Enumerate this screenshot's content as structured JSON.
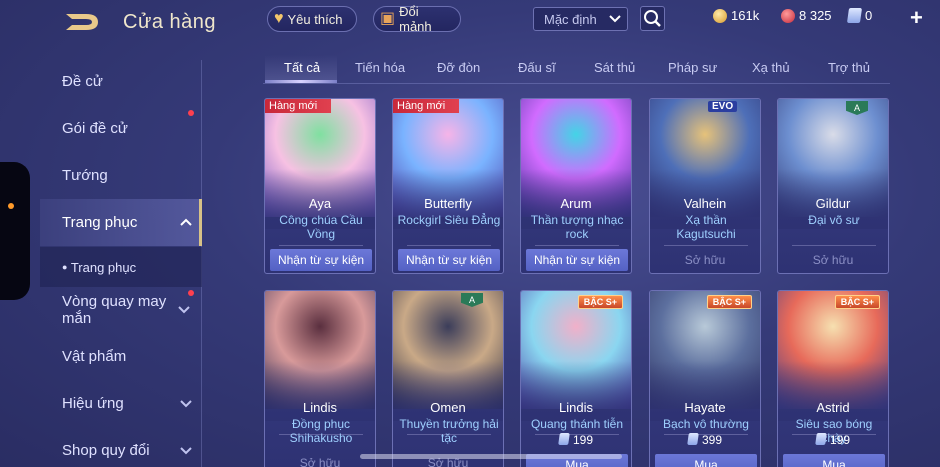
{
  "header": {
    "title": "Cửa hàng",
    "favorite_label": "Yêu thích",
    "fragment_label": "Đổi mảnh",
    "sort_value": "Mặc định",
    "gold": "161k",
    "ruby": "8 325",
    "voucher": "0"
  },
  "sidebar": {
    "items": [
      {
        "label": "Đề cử"
      },
      {
        "label": "Gói đề cử"
      },
      {
        "label": "Tướng"
      },
      {
        "label": "Trang phục"
      },
      {
        "label": "Trang phục"
      },
      {
        "label": "Vòng quay may mắn"
      },
      {
        "label": "Vật phẩm"
      },
      {
        "label": "Hiệu ứng"
      },
      {
        "label": "Shop quy đổi"
      }
    ]
  },
  "tabs": [
    "Tất cả",
    "Tiến hóa",
    "Đỡ đòn",
    "Đấu sĩ",
    "Sát thủ",
    "Pháp sư",
    "Xạ thủ",
    "Trợ thủ"
  ],
  "cards": [
    {
      "hero": "Aya",
      "skin": "Công chúa Cầu Vồng",
      "action": "Nhận từ sự kiện",
      "ribbon": "Hàng mới",
      "colors": [
        "#7fe0a0",
        "#f7c1e3",
        "#6a4fbf"
      ]
    },
    {
      "hero": "Butterfly",
      "skin": "Rockgirl Siêu Đẳng",
      "action": "Nhận từ sự kiện",
      "ribbon": "Hàng mới",
      "colors": [
        "#f6b4e8",
        "#7ab3ff",
        "#4b3aa5"
      ]
    },
    {
      "hero": "Arum",
      "skin": "Thần tượng nhạc rock",
      "action": "Nhận từ sự kiện",
      "colors": [
        "#43d4e6",
        "#d16bff",
        "#3c2f93"
      ]
    },
    {
      "hero": "Valhein",
      "skin": "Xạ thần Kagutsuchi",
      "status": "Sở hữu",
      "badge": "EVO",
      "colors": [
        "#e6c27a",
        "#4e6fb8",
        "#2d2f6e"
      ]
    },
    {
      "hero": "Gildur",
      "skin": "Đại võ sư",
      "status": "Sở hữu",
      "badge": "A",
      "colors": [
        "#d9dce8",
        "#6d8fd0",
        "#2f3673"
      ]
    },
    {
      "hero": "Lindis",
      "skin": "Đồng phục Shihakusho",
      "status": "Sở hữu",
      "colors": [
        "#5a2f3f",
        "#d89a9a",
        "#2b2850"
      ]
    },
    {
      "hero": "Omen",
      "skin": "Thuyền trưởng hải tặc",
      "status": "Sở hữu",
      "badge": "A",
      "colors": [
        "#3b3d5a",
        "#c9a987",
        "#23253f"
      ]
    },
    {
      "hero": "Lindis",
      "skin": "Quang thánh tiễn",
      "price": "199",
      "action": "Mua",
      "badge": "BẬC S+",
      "colors": [
        "#f1b0c9",
        "#8ad6f0",
        "#4a3aa2"
      ]
    },
    {
      "hero": "Hayate",
      "skin": "Bạch vô thường",
      "price": "399",
      "action": "Mua",
      "badge": "BẬC S+",
      "colors": [
        "#b8c9d8",
        "#5c6f9e",
        "#2c2f60"
      ]
    },
    {
      "hero": "Astrid",
      "skin": "Siêu sao bóng chày",
      "price": "199",
      "action": "Mua",
      "badge": "BẬC S+",
      "colors": [
        "#f6e0b0",
        "#e76a5a",
        "#3a3a8a"
      ]
    }
  ]
}
